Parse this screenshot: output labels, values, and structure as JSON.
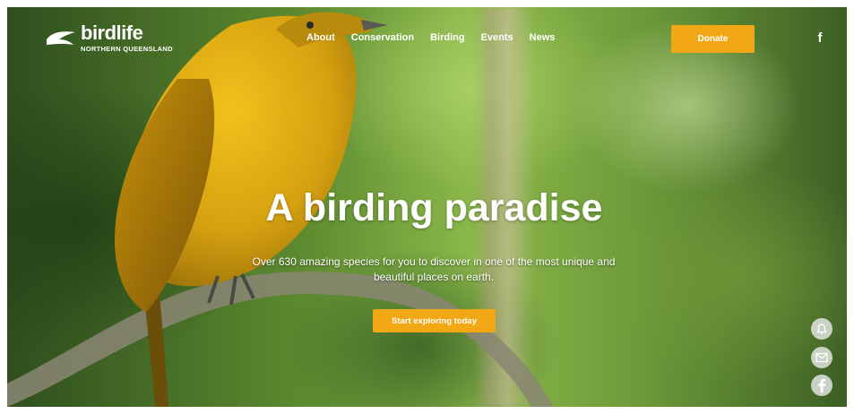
{
  "header": {
    "logo": {
      "name": "birdlife",
      "subtitle": "NORTHERN QUEENSLAND",
      "icon": "bird-logo-icon"
    },
    "nav": [
      {
        "label": "About"
      },
      {
        "label": "Conservation"
      },
      {
        "label": "Birding"
      },
      {
        "label": "Events"
      },
      {
        "label": "News"
      }
    ],
    "donate_label": "Donate",
    "social_icon": "facebook-icon",
    "social_glyph": "f"
  },
  "hero": {
    "title": "A birding paradise",
    "subtitle": "Over 630 amazing species for you to discover in one of the most unique and beautiful places on earth.",
    "cta_label": "Start exploring today"
  },
  "floating_buttons": [
    {
      "icon": "bell-icon"
    },
    {
      "icon": "mail-icon"
    },
    {
      "icon": "facebook-icon"
    }
  ],
  "colors": {
    "accent": "#f2a814",
    "text": "#ffffff",
    "bird_yellow": "#d8a90e"
  }
}
